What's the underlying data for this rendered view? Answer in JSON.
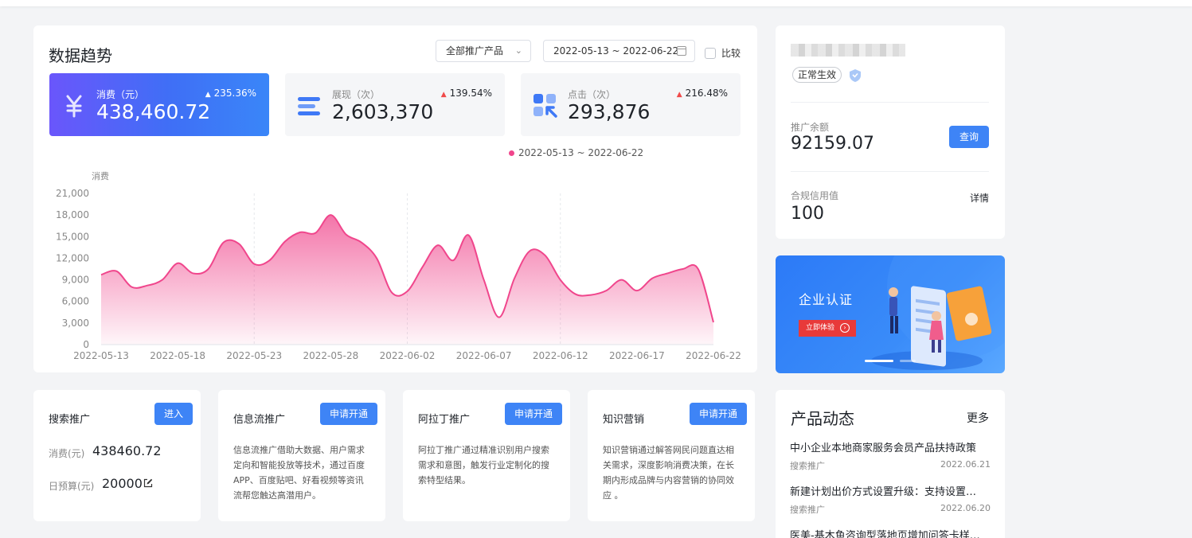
{
  "trend": {
    "title": "数据趋势",
    "product_select": "全部推广产品",
    "date_range": "2022-05-13 ~ 2022-06-22",
    "compare_label": "比较",
    "metrics": [
      {
        "label": "消费（元）",
        "value": "438,460.72",
        "change": "235.36%"
      },
      {
        "label": "展现（次）",
        "value": "2,603,370",
        "change": "139.54%"
      },
      {
        "label": "点击（次）",
        "value": "293,876",
        "change": "216.48%"
      }
    ],
    "legend": "2022-05-13 ~ 2022-06-22"
  },
  "chart_data": {
    "type": "area",
    "ylabel": "消费",
    "ylim": [
      0,
      21000
    ],
    "yticks": [
      "0",
      "3,000",
      "6,000",
      "9,000",
      "12,000",
      "15,000",
      "18,000",
      "21,000"
    ],
    "xticks": [
      "2022-05-13",
      "2022-05-18",
      "2022-05-23",
      "2022-05-28",
      "2022-06-02",
      "2022-06-07",
      "2022-06-12",
      "2022-06-17",
      "2022-06-22"
    ],
    "x": [
      "05-13",
      "05-14",
      "05-15",
      "05-16",
      "05-17",
      "05-18",
      "05-19",
      "05-20",
      "05-21",
      "05-22",
      "05-23",
      "05-24",
      "05-25",
      "05-26",
      "05-27",
      "05-28",
      "05-29",
      "05-30",
      "05-31",
      "06-01",
      "06-02",
      "06-03",
      "06-04",
      "06-05",
      "06-06",
      "06-07",
      "06-08",
      "06-09",
      "06-10",
      "06-11",
      "06-12",
      "06-13",
      "06-14",
      "06-15",
      "06-16",
      "06-17",
      "06-18",
      "06-19",
      "06-20",
      "06-21",
      "06-22"
    ],
    "series": [
      {
        "values": [
          9700,
          10200,
          8000,
          8200,
          9000,
          11300,
          9900,
          10500,
          14200,
          14000,
          11200,
          11700,
          14300,
          15600,
          15500,
          18000,
          15300,
          14200,
          12000,
          7200,
          7400,
          10800,
          13800,
          11700,
          15200,
          9000,
          3800,
          9200,
          13000,
          12400,
          9000,
          7000,
          6900,
          7500,
          9000,
          7500,
          9200,
          9900,
          10500,
          10500,
          3100
        ]
      }
    ],
    "color": "#f0468c"
  },
  "account": {
    "status": "正常生效",
    "balance_label": "推广余额",
    "balance": "92159.07",
    "query_button": "查询",
    "credit_label": "合规信用值",
    "credit": "100",
    "detail_link": "详情"
  },
  "banner": {
    "title": "企业认证",
    "button": "立即体验"
  },
  "products": [
    {
      "title": "搜索推广",
      "button": "进入",
      "spend_label": "消费(元)",
      "spend": "438460.72",
      "budget_label": "日预算(元)",
      "budget": "20000"
    },
    {
      "title": "信息流推广",
      "button": "申请开通",
      "desc": "信息流推广借助大数据、用户需求定向和智能投放等技术，通过百度APP、百度贴吧、好看视频等资讯流帮您触达高潜用户。"
    },
    {
      "title": "阿拉丁推广",
      "button": "申请开通",
      "desc": "阿拉丁推广通过精准识别用户搜索需求和意图，触发行业定制化的搜索特型结果。"
    },
    {
      "title": "知识营销",
      "button": "申请开通",
      "desc": "知识营销通过解答网民问题直达相关需求，深度影响消费决策，在长期内形成品牌与内容营销的协同效应 。"
    }
  ],
  "news": {
    "title": "产品动态",
    "more": "更多",
    "items": [
      {
        "title": "中小企业本地商家服务会员产品扶持政策",
        "tag": "搜索推广",
        "date": "2022.06.21"
      },
      {
        "title": "新建计划出价方式设置升级：支持设置…",
        "tag": "搜索推广",
        "date": "2022.06.20"
      },
      {
        "title": "医美-基木鱼咨询型落地页增加问答卡样…",
        "tag": "",
        "date": ""
      }
    ]
  }
}
